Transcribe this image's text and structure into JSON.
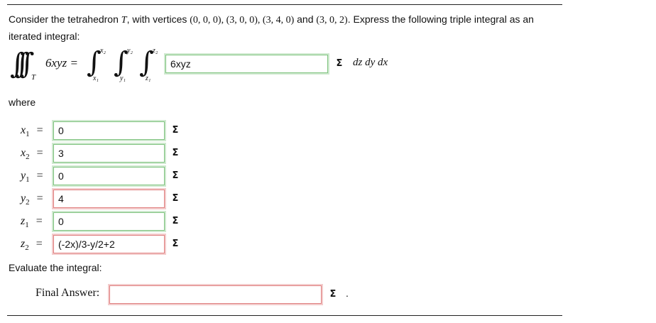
{
  "prompt": {
    "intro": "Consider the tetrahedron",
    "T": "T",
    "vertices_intro": ", with vertices",
    "vertices_math": "(0, 0, 0), (3, 0, 0), (3, 4, 0)",
    "and": "and",
    "last_vertex": "(3, 0, 2)",
    "rest": ". Express the following triple integral as an iterated integral:"
  },
  "equation": {
    "integrand_left": "6xyz =",
    "region": "T",
    "upper_x": "x₂",
    "lower_x": "x₁",
    "upper_y": "y₂",
    "lower_y": "y₁",
    "upper_z": "z₂",
    "lower_z": "z₁",
    "integrand_value": "6xyz",
    "differentials": "dz dy dx"
  },
  "where_label": "where",
  "limits": [
    {
      "var": "x",
      "sub": "1",
      "value": "0",
      "status": "correct"
    },
    {
      "var": "x",
      "sub": "2",
      "value": "3",
      "status": "correct"
    },
    {
      "var": "y",
      "sub": "1",
      "value": "0",
      "status": "correct"
    },
    {
      "var": "y",
      "sub": "2",
      "value": "4",
      "status": "incorrect"
    },
    {
      "var": "z",
      "sub": "1",
      "value": "0",
      "status": "correct"
    },
    {
      "var": "z",
      "sub": "2",
      "value": "(-2x)/3-y/2+2",
      "status": "incorrect"
    }
  ],
  "evaluate_label": "Evaluate the integral:",
  "final_answer_label": "Final Answer:",
  "final_answer_value": "",
  "final_period": ".",
  "sigma_symbol": "Σ",
  "colors": {
    "correct": "#7fc37f",
    "incorrect": "#e08080"
  }
}
